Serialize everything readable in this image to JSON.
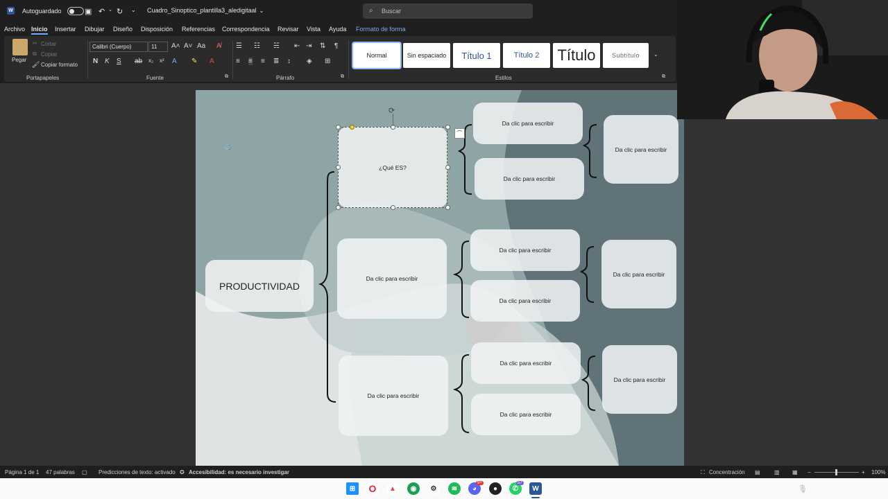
{
  "titlebar": {
    "autosave_label": "Autoguardado",
    "doc_title": "Cuadro_Sinoptico_plantilla3_aledigitaal",
    "search_placeholder": "Buscar"
  },
  "menu": {
    "items": [
      "Archivo",
      "Inicio",
      "Insertar",
      "Dibujar",
      "Diseño",
      "Disposición",
      "Referencias",
      "Correspondencia",
      "Revisar",
      "Vista",
      "Ayuda",
      "Formato de forma"
    ],
    "active": "Inicio"
  },
  "ribbon": {
    "clipboard": {
      "paste": "Pegar",
      "cut": "Cortar",
      "copy": "Copiar",
      "format_painter": "Copiar formato",
      "label": "Portapapeles"
    },
    "font": {
      "name": "Calibri (Cuerpo)",
      "size": "11",
      "label": "Fuente"
    },
    "paragraph": {
      "label": "Párrafo"
    },
    "styles": {
      "label": "Estilos",
      "items": [
        "Normal",
        "Sin espaciado",
        "Título 1",
        "Título 2",
        "Título",
        "Subtítulo"
      ]
    }
  },
  "diagram": {
    "root": "PRODUCTIVIDAD",
    "level1": [
      "¿Qué ES?",
      "Da clic para escribir",
      "Da clic para escribir"
    ],
    "level2": [
      "Da clic para escribir",
      "Da clic para escribir",
      "Da clic para escribir",
      "Da clic para escribir",
      "Da clic para escribir",
      "Da clic para escribir"
    ],
    "level3": [
      "Da clic para escribir",
      "Da clic para escribir",
      "Da clic para escribir"
    ]
  },
  "status": {
    "page": "Página 1 de 1",
    "words": "47 palabras",
    "predictions": "Predicciones de texto: activado",
    "accessibility": "Accesibilidad: es necesario investigar",
    "focus": "Concentración",
    "zoom": "100%"
  },
  "taskbar": {
    "discord_badge": "9+",
    "whatsapp_badge": "57"
  },
  "colors": {
    "accent": "#7aa7ff",
    "shape_tab": "#7ea7e8",
    "page_teal": "#8fa5a5",
    "page_dark": "#5f7378"
  }
}
